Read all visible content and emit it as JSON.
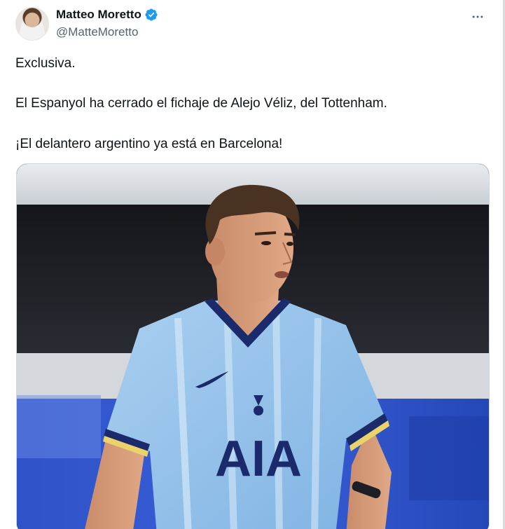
{
  "author": {
    "display_name": "Matteo Moretto",
    "handle": "@MatteMoretto",
    "verified": true,
    "avatar_icon": "user-avatar"
  },
  "tweet": {
    "lines": [
      "Exclusiva.",
      "El Espanyol ha cerrado el fichaje de Alejo Véliz, del Tottenham.",
      "¡El delantero argentino ya está en Barcelona!"
    ]
  },
  "media": {
    "kind": "photo",
    "shirt_sponsor": "AIA"
  },
  "actions": {
    "more_icon": "more-horizontal-icon"
  },
  "colors": {
    "verified_blue": "#1d9bf0",
    "handle_gray": "#536471",
    "text": "#0f1419"
  }
}
